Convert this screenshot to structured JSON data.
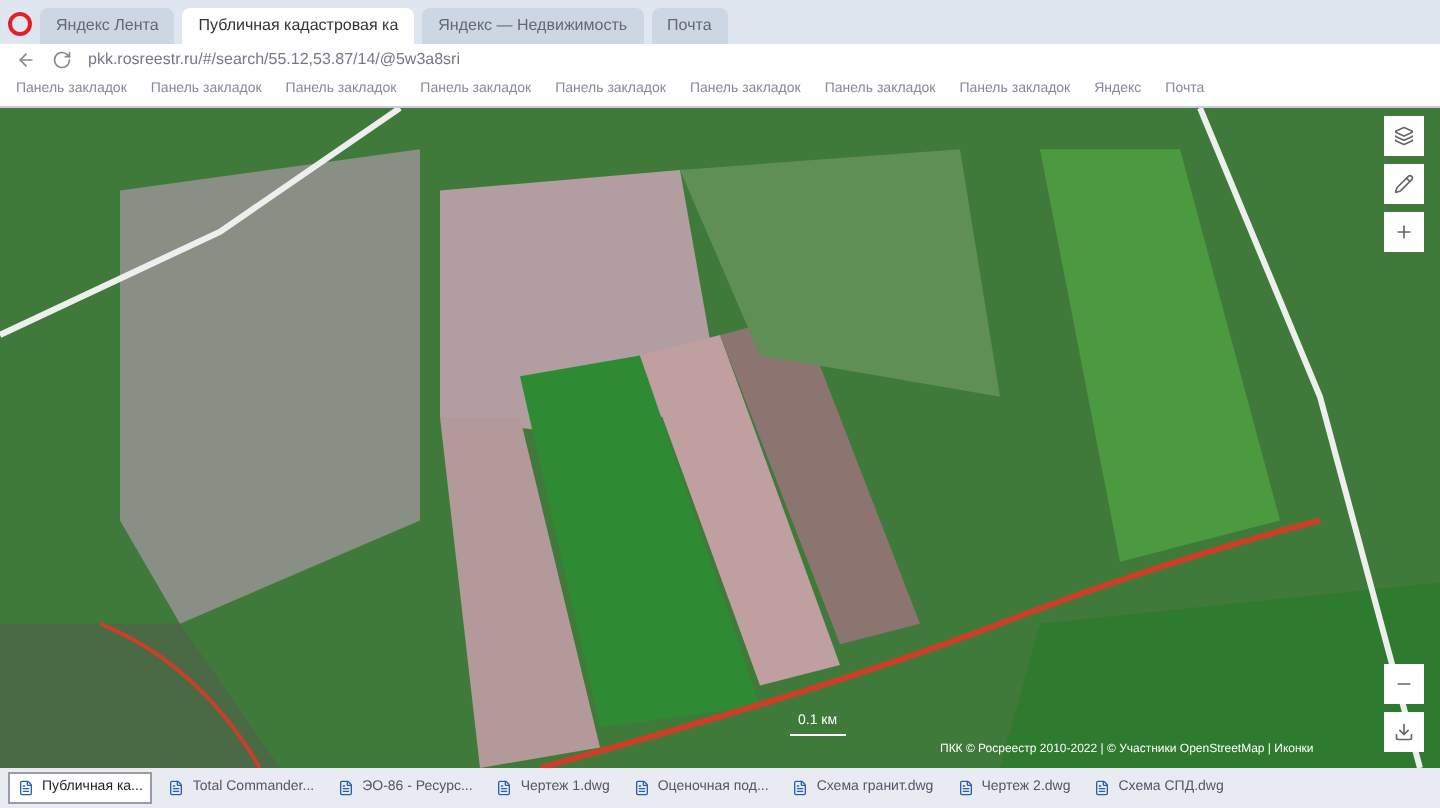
{
  "browser": {
    "tabs": [
      {
        "label": "Яндекс Лента",
        "selected": false
      },
      {
        "label": "Публичная кадастровая ка",
        "selected": true
      },
      {
        "label": "Яндекс — Недвижимость",
        "selected": false
      },
      {
        "label": "Почта",
        "selected": false
      }
    ],
    "address": "pkk.rosreestr.ru/#/search/55.12,53.87/14/@5w3a8sri",
    "bookmarks": [
      "Панель закладок",
      "Панель закладок",
      "Панель закладок",
      "Панель закладок",
      "Панель закладок",
      "Панель закладок",
      "Панель закладок",
      "Панель закладок",
      "Яндекс",
      "Почта"
    ]
  },
  "map": {
    "scale": "0.1 км",
    "attribution": "ПКК © Росреестр 2010-2022 | © Участники OpenStreetMap | Иконки"
  },
  "taskbar": [
    {
      "label": "Публичная ка...",
      "selected": true
    },
    {
      "label": "Total Commander...",
      "selected": false
    },
    {
      "label": "ЭО-86 - Ресурс...",
      "selected": false
    },
    {
      "label": "Чертеж 1.dwg",
      "selected": false
    },
    {
      "label": "Оценочная под...",
      "selected": false
    },
    {
      "label": "Схема гранит.dwg",
      "selected": false
    },
    {
      "label": "Чертеж 2.dwg",
      "selected": false
    },
    {
      "label": "Схема СПД.dwg",
      "selected": false
    }
  ]
}
